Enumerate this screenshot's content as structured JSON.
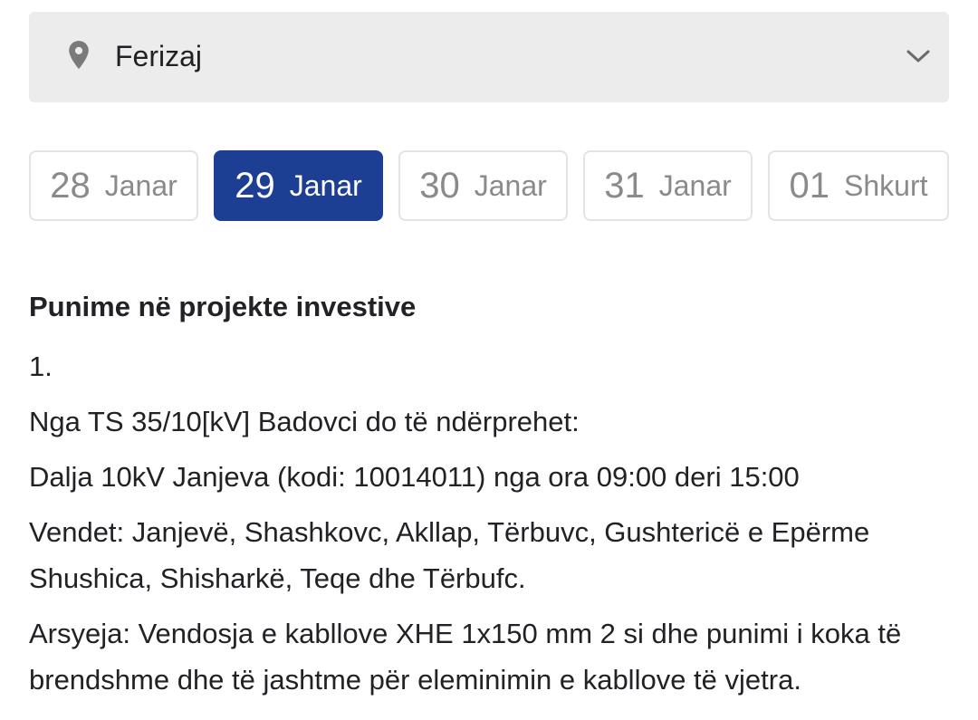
{
  "location": {
    "selected": "Ferizaj",
    "icon": "location-pin-icon",
    "dropdown_icon": "chevron-down-icon"
  },
  "dates": [
    {
      "day": "28",
      "month": "Janar",
      "active": false
    },
    {
      "day": "29",
      "month": "Janar",
      "active": true
    },
    {
      "day": "30",
      "month": "Janar",
      "active": false
    },
    {
      "day": "31",
      "month": "Janar",
      "active": false
    },
    {
      "day": "01",
      "month": "Shkurt",
      "active": false
    }
  ],
  "colors": {
    "accent": "#1c3f94",
    "select_bg": "#ececec",
    "chip_border": "#e3e3e3",
    "muted_text": "#8a8a8a"
  },
  "notice": {
    "title": "Punime në projekte investive",
    "number": "1.",
    "source": "Nga TS 35/10[kV] Badovci do të ndërprehet:",
    "line": "Dalja 10kV Janjeva (kodi: 10014011) nga ora 09:00 deri 15:00",
    "places": "Vendet: Janjevë, Shashkovc, Akllap, Tërbuvc, Gushtericë e Epërme Shushica, Shisharkë, Teqe dhe Tërbufc.",
    "reason": "Arsyeja: Vendosja e kabllove XHE 1x150 mm 2 si dhe punimi i koka të brendshme dhe të jashtme për eleminimin e kabllove të vjetra."
  }
}
